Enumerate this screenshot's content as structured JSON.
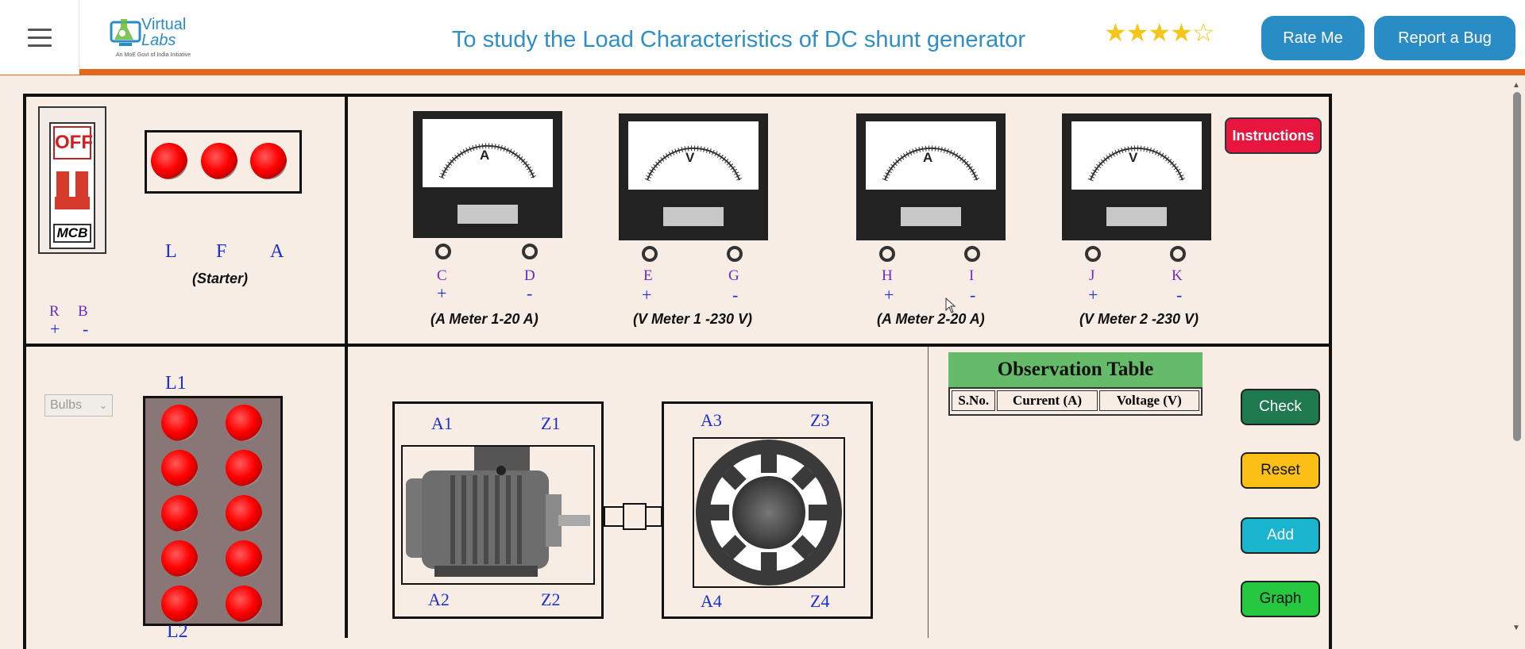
{
  "header": {
    "logo_word1": "Virtual",
    "logo_word2": "Labs",
    "logo_tagline": "An MoE Govt of India Initiative",
    "title": "To study the Load Characteristics of DC shunt generator",
    "rating": 4,
    "rating_max": 5,
    "rate_label": "Rate Me",
    "bug_label": "Report a Bug"
  },
  "top_left": {
    "mcb_off": "OFF",
    "mcb_label": "MCB",
    "starter_terminals": [
      "L",
      "F",
      "A"
    ],
    "starter_label": "(Starter)",
    "supply_terminals": [
      "R",
      "B"
    ],
    "supply_polarity": [
      "+",
      "-"
    ]
  },
  "meters": [
    {
      "symbol": "A",
      "t1": "C",
      "t2": "D",
      "p1": "+",
      "p2": "-",
      "caption": "(A Meter 1-20 A)"
    },
    {
      "symbol": "V",
      "t1": "E",
      "t2": "G",
      "p1": "+",
      "p2": "-",
      "caption": "(V Meter 1 -230 V)"
    },
    {
      "symbol": "A",
      "t1": "H",
      "t2": "I",
      "p1": "+",
      "p2": "-",
      "caption": "(A Meter 2-20 A)"
    },
    {
      "symbol": "V",
      "t1": "J",
      "t2": "K",
      "p1": "+",
      "p2": "-",
      "caption": "(V Meter 2 -230 V)"
    }
  ],
  "instructions_label": "Instructions",
  "load": {
    "select_value": "Bulbs",
    "l1": "L1",
    "l2": "L2"
  },
  "motor": {
    "a1": "A1",
    "z1": "Z1",
    "a2": "A2",
    "z2": "Z2"
  },
  "generator": {
    "a3": "A3",
    "z3": "Z3",
    "a4": "A4",
    "z4": "Z4"
  },
  "observation": {
    "title": "Observation Table",
    "columns": [
      "S.No.",
      "Current (A)",
      "Voltage (V)"
    ]
  },
  "actions": {
    "check": "Check",
    "reset": "Reset",
    "add": "Add",
    "graph": "Graph"
  },
  "colors": {
    "accent_blue": "#2a8cc4",
    "header_border": "#e5661c",
    "check": "#1e7a4e",
    "reset": "#fbbf16",
    "add": "#1ab4cf",
    "graph": "#26c840",
    "instructions": "#e8163f"
  }
}
